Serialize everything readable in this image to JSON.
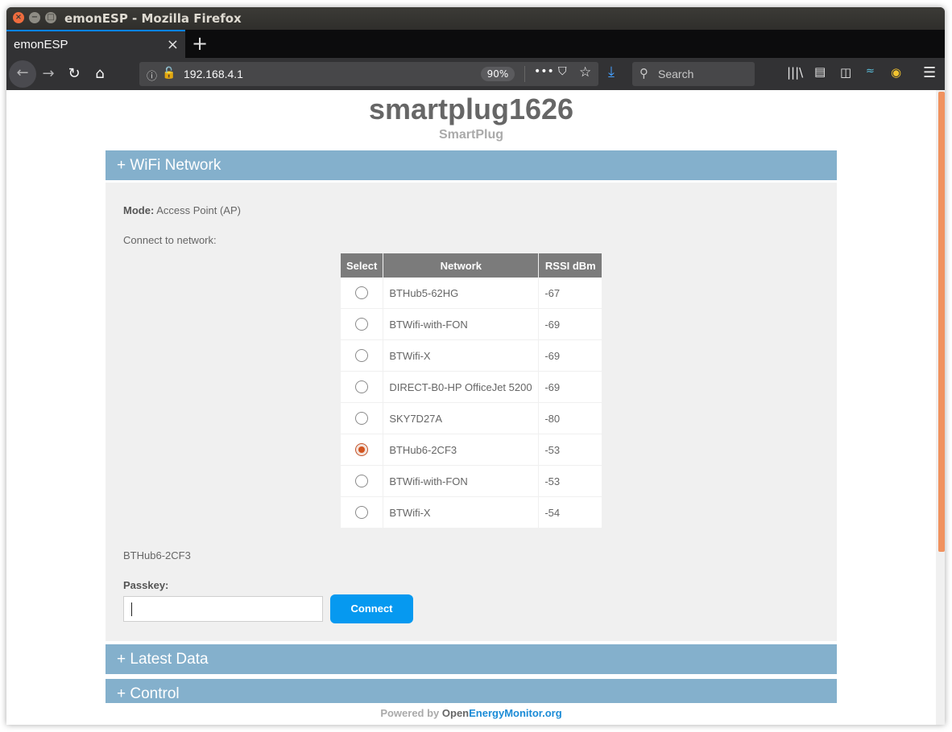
{
  "window": {
    "title": "emonESP - Mozilla Firefox",
    "controls": {
      "close": "×",
      "minimize": "−",
      "maximize": "□"
    }
  },
  "tab": {
    "label": "emonESP",
    "close": "×",
    "new_tab": "+"
  },
  "navbar": {
    "back": "←",
    "forward": "→",
    "reload": "↻",
    "home": "⌂",
    "url": "192.168.4.1",
    "zoom": "90%",
    "more": "•••",
    "search_placeholder": "Search"
  },
  "page": {
    "title": "smartplug1626",
    "subtitle": "SmartPlug",
    "wifi_section": {
      "header": "+ WiFi Network",
      "mode_label": "Mode:",
      "mode_value": "Access Point (AP)",
      "connect_label": "Connect to network:",
      "columns": [
        "Select",
        "Network",
        "RSSI dBm"
      ],
      "networks": [
        {
          "name": "BTHub5-62HG",
          "rssi": "-67",
          "selected": false
        },
        {
          "name": "BTWifi-with-FON",
          "rssi": "-69",
          "selected": false
        },
        {
          "name": "BTWifi-X",
          "rssi": "-69",
          "selected": false
        },
        {
          "name": "DIRECT-B0-HP OfficeJet 5200",
          "rssi": "-69",
          "selected": false
        },
        {
          "name": "SKY7D27A",
          "rssi": "-80",
          "selected": false
        },
        {
          "name": "BTHub6-2CF3",
          "rssi": "-53",
          "selected": true
        },
        {
          "name": "BTWifi-with-FON",
          "rssi": "-53",
          "selected": false
        },
        {
          "name": "BTWifi-X",
          "rssi": "-54",
          "selected": false
        }
      ],
      "selected_network": "BTHub6-2CF3",
      "passkey_label": "Passkey:",
      "passkey_value": "",
      "connect_button": "Connect"
    },
    "latest_data_header": "+ Latest Data",
    "control_header": "+ Control",
    "footer": {
      "powered_by": "Powered by ",
      "open": "Open",
      "energy": "EnergyMonitor.org"
    }
  },
  "colors": {
    "section_header": "#84b0cc",
    "connect_button": "#0699f0",
    "scrollbar_thumb": "#f0925f"
  }
}
